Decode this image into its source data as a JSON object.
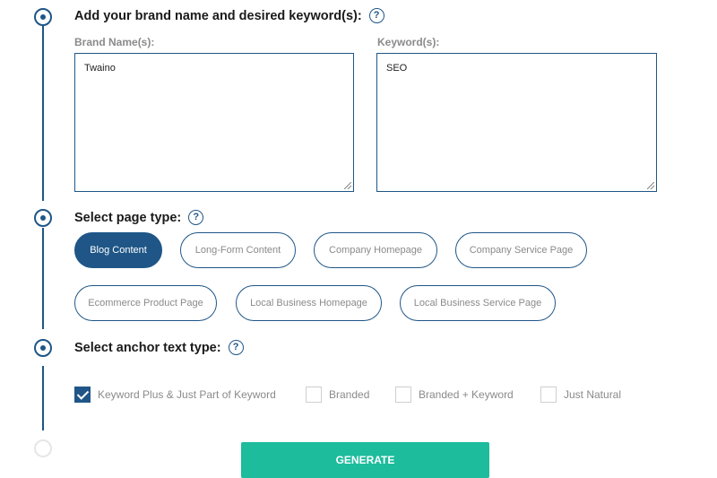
{
  "step1": {
    "title": "Add your brand name and desired keyword(s):",
    "brand_label": "Brand Name(s):",
    "brand_value": "Twaino",
    "keyword_label": "Keyword(s):",
    "keyword_value": "SEO"
  },
  "step2": {
    "title": "Select page type:",
    "options": [
      {
        "label": "Blog Content",
        "selected": true
      },
      {
        "label": "Long-Form Content",
        "selected": false
      },
      {
        "label": "Company Homepage",
        "selected": false
      },
      {
        "label": "Company Service Page",
        "selected": false
      },
      {
        "label": "Ecommerce Product Page",
        "selected": false
      },
      {
        "label": "Local Business Homepage",
        "selected": false
      },
      {
        "label": "Local Business Service Page",
        "selected": false
      }
    ]
  },
  "step3": {
    "title": "Select anchor text type:",
    "options": [
      {
        "label": "Keyword Plus & Just Part of Keyword",
        "checked": true
      },
      {
        "label": "Branded",
        "checked": false
      },
      {
        "label": "Branded + Keyword",
        "checked": false
      },
      {
        "label": "Just Natural",
        "checked": false
      }
    ]
  },
  "help_symbol": "?",
  "generate_label": "GENERATE",
  "colors": {
    "primary": "#1f5687",
    "accent": "#1cbc9c",
    "muted": "#8a8a8a"
  }
}
